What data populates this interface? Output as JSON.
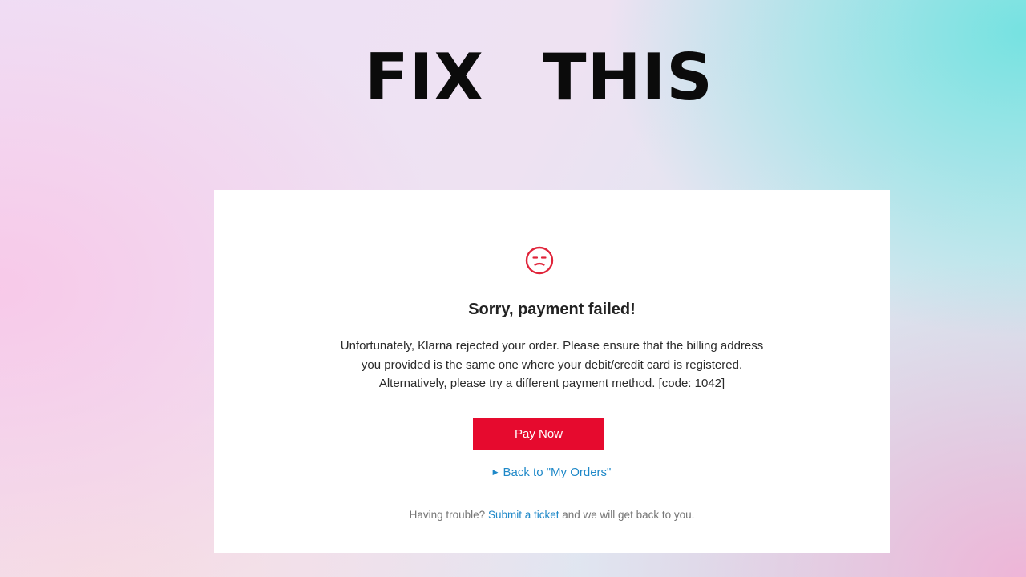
{
  "overlay_title": {
    "word1": "FIX",
    "word2": "THIS"
  },
  "dialog": {
    "icon": "sad-face-icon",
    "heading": "Sorry, payment failed!",
    "message_lines": [
      "Unfortunately, Klarna rejected your order. Please ensure that the billing address",
      "you provided is the same one where your debit/credit card is registered.",
      "Alternatively, please try a different payment method. [code: 1042]"
    ],
    "pay_button_label": "Pay Now",
    "back_link_label": "Back to \"My Orders\"",
    "help": {
      "prefix": "Having trouble?",
      "link_label": "Submit a ticket",
      "suffix": "and we will get back to you."
    }
  },
  "colors": {
    "accent_red": "#e60a2e",
    "link_blue": "#1e88c8",
    "icon_red": "#e0243a"
  }
}
